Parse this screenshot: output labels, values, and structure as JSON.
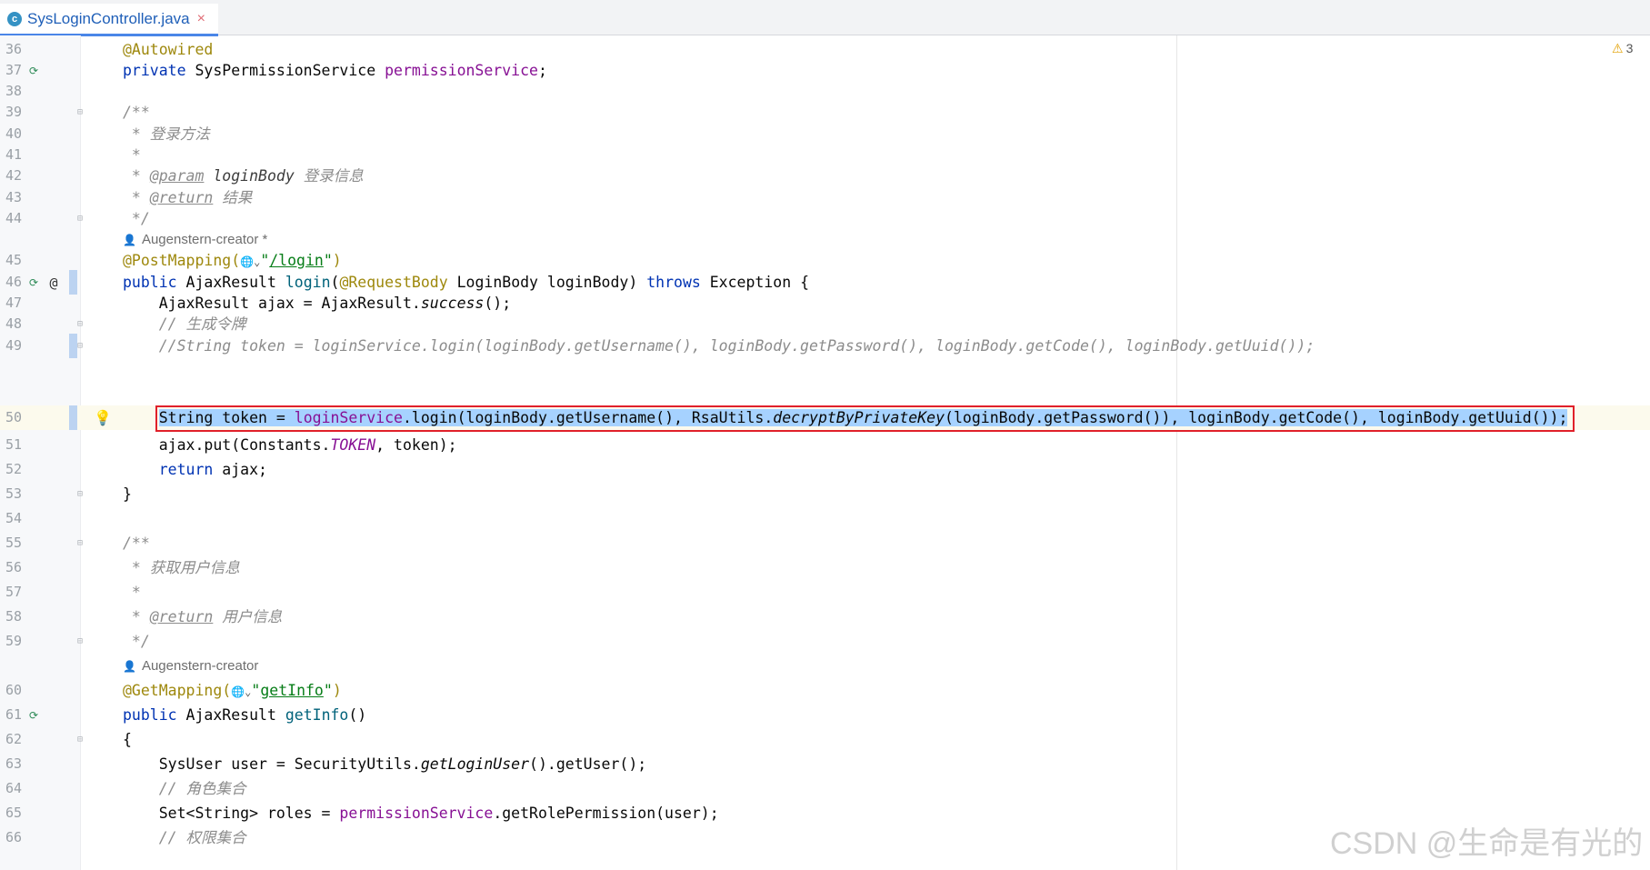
{
  "tab": {
    "icon": "class-icon",
    "icon_letter": "c",
    "file_name": "SysLoginController.java",
    "close": "×"
  },
  "inspections": {
    "icon": "warning-icon",
    "count": "3"
  },
  "lines": {
    "l36": "36",
    "l37": "37",
    "l38": "38",
    "l39": "39",
    "l40": "40",
    "l41": "41",
    "l42": "42",
    "l43": "43",
    "l44": "44",
    "l45": "45",
    "l46": "46",
    "l47": "47",
    "l48": "48",
    "l49": "49",
    "l50": "50",
    "l51": "51",
    "l52": "52",
    "l53": "53",
    "l54": "54",
    "l55": "55",
    "l56": "56",
    "l57": "57",
    "l58": "58",
    "l59": "59",
    "l60": "60",
    "l61": "61",
    "l62": "62",
    "l63": "63",
    "l64": "64",
    "l65": "65",
    "l66": "66"
  },
  "code": {
    "autowired": "@Autowired",
    "l37_private": "private",
    "l37_type": " SysPermissionService ",
    "l37_field": "permissionService",
    "l37_end": ";",
    "doc_open": "/**",
    "l40": " * 登录方法",
    "l41": " *",
    "l42_star": " * ",
    "l42_tag": "@param",
    "l42_name": " loginBody",
    "l42_desc": " 登录信息",
    "l43_star": " * ",
    "l43_tag": "@return",
    "l43_desc": " 结果",
    "doc_close": " */",
    "author1": "Augenstern-creator *",
    "l45_anno": "@PostMapping(",
    "l45_globe": "🌐⌄",
    "l45_q1": "\"",
    "l45_url": "/login",
    "l45_q2": "\"",
    "l45_end": ")",
    "l46_public": "public",
    "l46_type": " AjaxResult ",
    "l46_method": "login",
    "l46_p1": "(",
    "l46_anno": "@RequestBody",
    "l46_params": " LoginBody loginBody) ",
    "l46_throws": "throws",
    "l46_exc": " Exception {",
    "l47_a": "    AjaxResult ajax = AjaxResult.",
    "l47_b": "success",
    "l47_c": "();",
    "l48": "    // 生成令牌",
    "l49": "    //String token = loginService.login(loginBody.getUsername(), loginBody.getPassword(), loginBody.getCode(), loginBody.getUuid());",
    "l50_indent": "    ",
    "l50_a": "String token = ",
    "l50_b": "loginService",
    "l50_c": ".login(loginBody.getUsername(), RsaUtils.",
    "l50_d": "decryptByPrivateKey",
    "l50_e": "(loginBody.getPassword()), loginBody.getCode(), loginBody.getUuid());",
    "l51_a": "    ajax.put(Constants.",
    "l51_b": "TOKEN",
    "l51_c": ", token);",
    "l52_indent": "    ",
    "l52_return": "return",
    "l52_rest": " ajax;",
    "l53": "}",
    "l56": " * 获取用户信息",
    "l57": " *",
    "l58_star": " * ",
    "l58_tag": "@return",
    "l58_desc": " 用户信息",
    "author2": "Augenstern-creator",
    "l60_anno": "@GetMapping(",
    "l60_globe": "🌐⌄",
    "l60_q1": "\"",
    "l60_url": "getInfo",
    "l60_q2": "\"",
    "l60_end": ")",
    "l61_public": "public",
    "l61_type": " AjaxResult ",
    "l61_method": "getInfo",
    "l61_end": "()",
    "l62": "{",
    "l63_a": "    SysUser user = SecurityUtils.",
    "l63_b": "getLoginUser",
    "l63_c": "().getUser();",
    "l64": "    // 角色集合",
    "l65_a": "    Set<String> roles = ",
    "l65_b": "permissionService",
    "l65_c": ".getRolePermission(user);",
    "l66": "    // 权限集合"
  },
  "watermark": "CSDN @生命是有光的",
  "colors": {
    "keyword": "#0033b3",
    "annotation": "#9e880d",
    "comment": "#8c8c8c",
    "field": "#871094",
    "method": "#00627a",
    "string": "#067d17",
    "selection": "#a6d2ff",
    "highlight_box": "#e0202a"
  }
}
